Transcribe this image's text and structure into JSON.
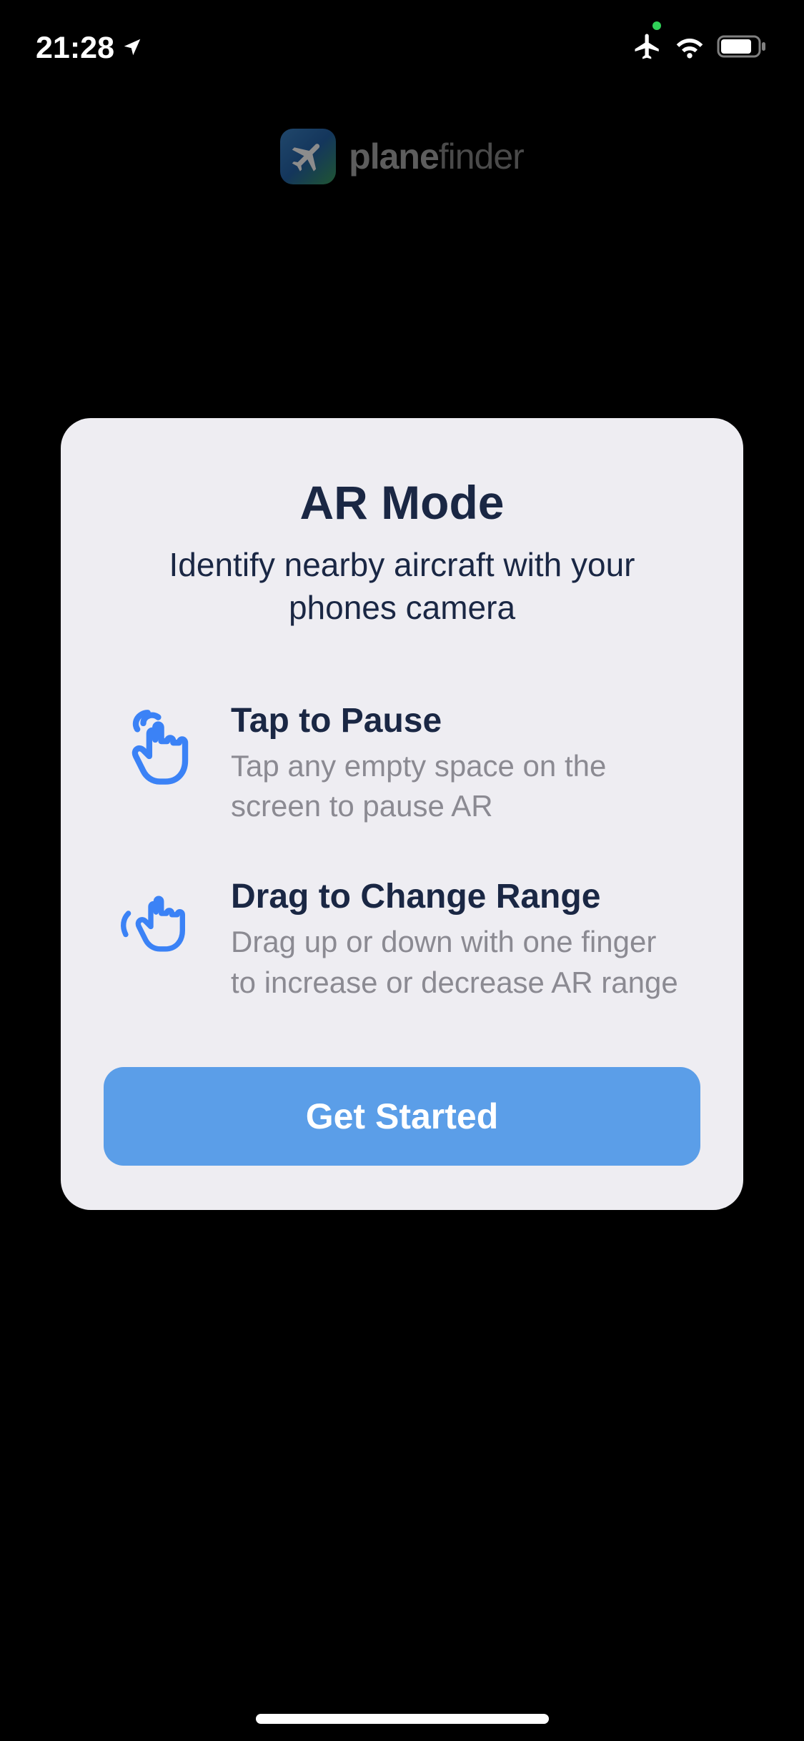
{
  "statusBar": {
    "time": "21:28"
  },
  "logo": {
    "textBold": "plane",
    "textLight": "finder"
  },
  "modal": {
    "title": "AR Mode",
    "subtitle": "Identify nearby aircraft with your phones camera",
    "features": [
      {
        "title": "Tap to Pause",
        "description": "Tap any empty space on the screen to pause AR"
      },
      {
        "title": "Drag to Change Range",
        "description": "Drag up or down with one finger to increase or decrease AR range"
      }
    ],
    "ctaLabel": "Get Started"
  }
}
